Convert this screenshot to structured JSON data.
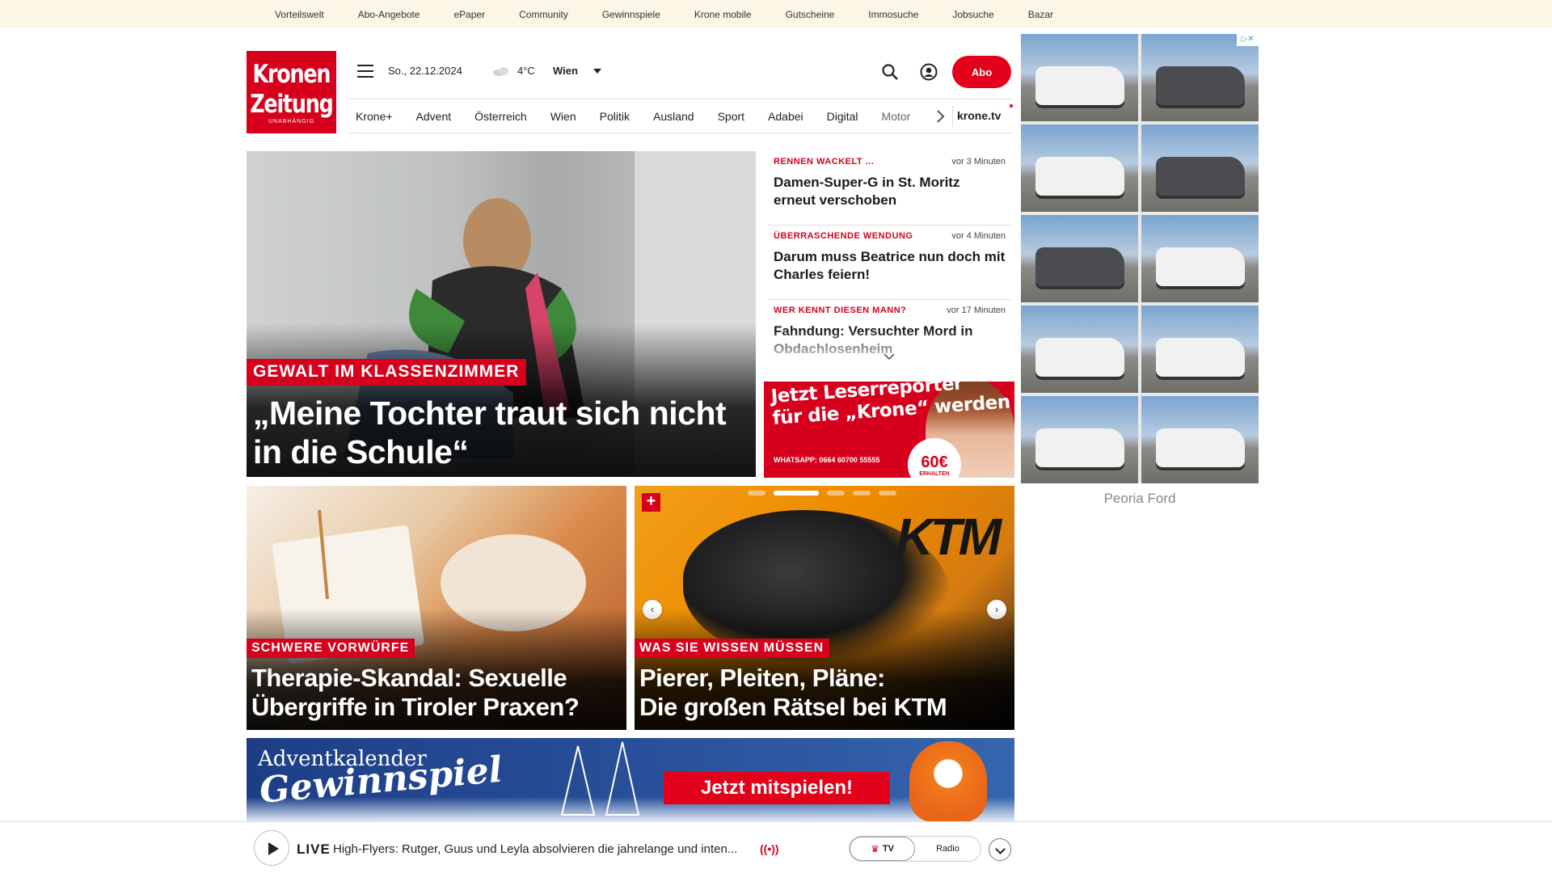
{
  "topbar": {
    "links": [
      "Vorteilswelt",
      "Abo-Angebote",
      "ePaper",
      "Community",
      "Gewinnspiele",
      "Krone mobile",
      "Gutscheine",
      "Immosuche",
      "Jobsuche",
      "Bazar"
    ]
  },
  "logo": {
    "line1": "Kronen",
    "line2": "Zeitung",
    "tagline": "UNABHÄNGIG"
  },
  "header": {
    "date": "So., 22.12.2024",
    "weather_icon": "cloud-icon",
    "temperature": "4°C",
    "city": "Wien",
    "abo_label": "Abo"
  },
  "nav": {
    "items": [
      "Krone+",
      "Advent",
      "Österreich",
      "Wien",
      "Politik",
      "Ausland",
      "Sport",
      "Adabei",
      "Digital",
      "Motor"
    ],
    "tv_label": "krone.tv"
  },
  "hero": {
    "kicker": "GEWALT IM KLASSENZIMMER",
    "title": "„Meine Tochter traut sich nicht in die Schule“"
  },
  "news": [
    {
      "kicker": "RENNEN WACKELT ...",
      "time": "vor 3 Minuten",
      "headline": "Damen-Super-G in St. Moritz erneut verschoben"
    },
    {
      "kicker": "ÜBERRASCHENDE WENDUNG",
      "time": "vor 4 Minuten",
      "headline": "Darum muss Beatrice nun doch mit Charles feiern!"
    },
    {
      "kicker": "WER KENNT DIESEN MANN?",
      "time": "vor 17 Minuten",
      "headline": "Fahndung: Versuchter Mord in Obdachlosenheim"
    }
  ],
  "leser_ad": {
    "line1": "Jetzt Leserreporter",
    "line2": "für die „Krone“ werden",
    "whatsapp": "WHATSAPP: 0664 60700 55555",
    "badge_amount": "60€",
    "badge_label": "ERHALTEN"
  },
  "teasers": [
    {
      "kicker": "SCHWERE VORWÜRFE",
      "title_line1": "Therapie-Skandal: Sexuelle",
      "title_line2": "Übergriffe in Tiroler Praxen?"
    },
    {
      "kicker": "WAS SIE WISSEN MÜSSEN",
      "title_line1": "Pierer, Pleiten, Pläne:",
      "title_line2": "Die großen Rätsel bei KTM",
      "brand": "KTM"
    }
  ],
  "advent_banner": {
    "line1": "Adventkalender",
    "line2": "Gewinnspiel",
    "cta": "Jetzt mitspielen!"
  },
  "ad": {
    "advertiser": "Peoria Ford"
  },
  "player": {
    "live_label": "LIVE",
    "now_playing": "High-Flyers: Rutger, Guus und Leyla absolvieren die jahrelange und inten...",
    "tv_label": "TV",
    "radio_label": "Radio"
  },
  "colors": {
    "brand_red": "#d6001c",
    "topbar_bg": "#fbf6e6"
  }
}
